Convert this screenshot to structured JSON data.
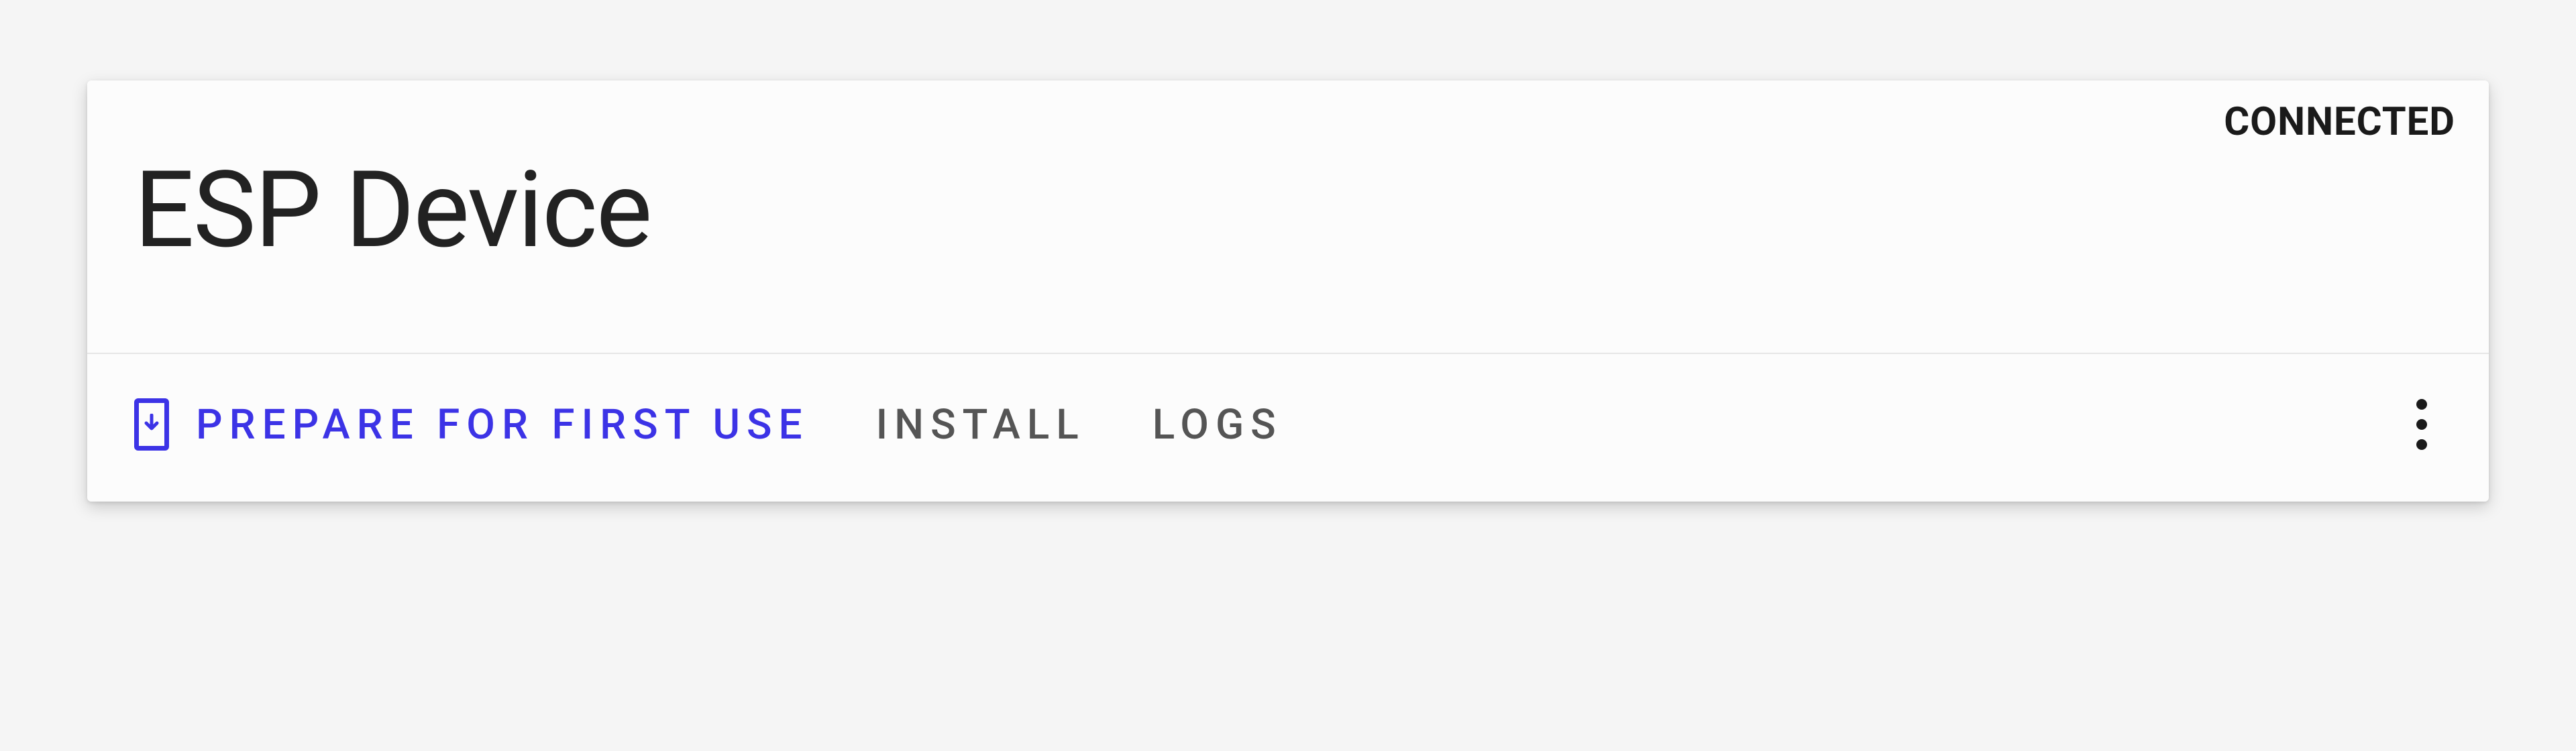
{
  "device": {
    "title": "ESP Device",
    "status": "CONNECTED"
  },
  "actions": {
    "prepare": "PREPARE FOR FIRST USE",
    "install": "INSTALL",
    "logs": "LOGS"
  },
  "colors": {
    "primary": "#3c33e6",
    "text_dark": "#1a1a1a",
    "text_muted": "#555"
  }
}
